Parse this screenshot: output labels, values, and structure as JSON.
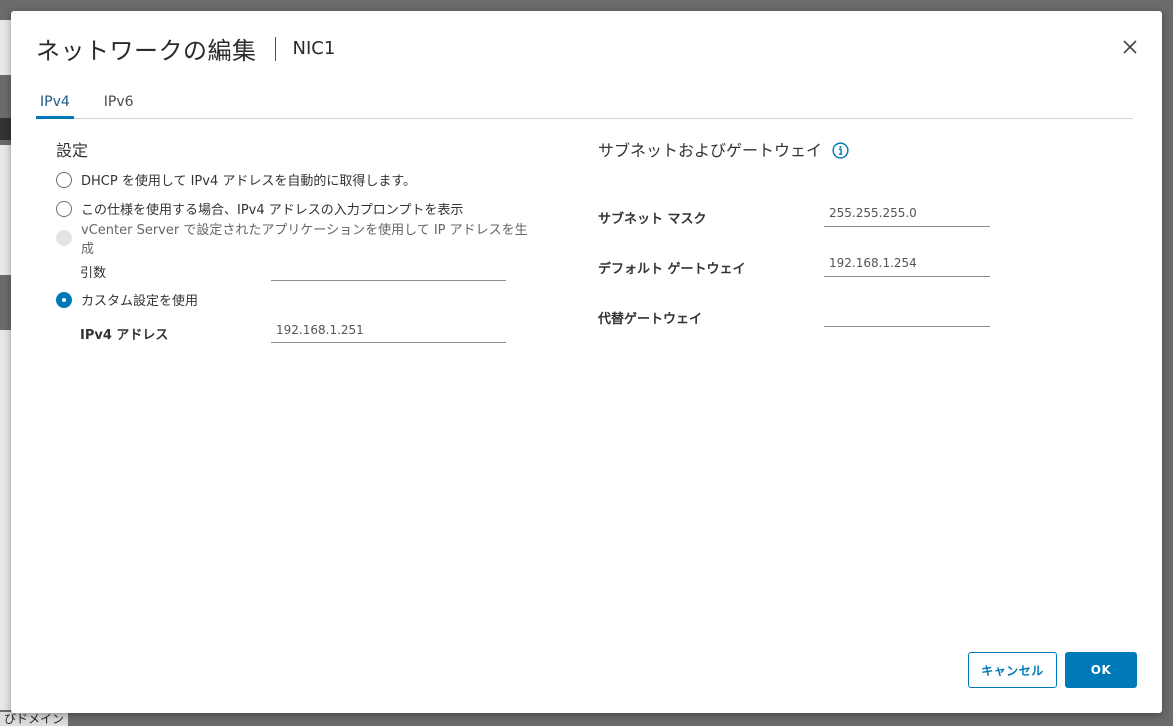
{
  "dialog": {
    "title": "ネットワークの編集",
    "subtitle": "NIC1"
  },
  "tabs": [
    {
      "label": "IPv4",
      "active": true
    },
    {
      "label": "IPv6",
      "active": false
    }
  ],
  "settings": {
    "title": "設定",
    "options": [
      {
        "label": "DHCP を使用して IPv4 アドレスを自動的に取得します。",
        "state": "unchecked"
      },
      {
        "label": "この仕様を使用する場合、IPv4 アドレスの入力プロンプトを表示",
        "state": "unchecked"
      },
      {
        "label": "vCenter Server で設定されたアプリケーションを使用して IP アドレスを生成",
        "state": "disabled"
      },
      {
        "label": "カスタム設定を使用",
        "state": "checked"
      }
    ],
    "argument_label": "引数",
    "argument_value": "",
    "ipv4_label": "IPv4 アドレス",
    "ipv4_value": "192.168.1.251"
  },
  "subnet": {
    "title": "サブネットおよびゲートウェイ",
    "info_icon": "info-icon",
    "fields": [
      {
        "label": "サブネット マスク",
        "value": "255.255.255.0"
      },
      {
        "label": "デフォルト ゲートウェイ",
        "value": "192.168.1.254"
      },
      {
        "label": "代替ゲートウェイ",
        "value": ""
      }
    ]
  },
  "buttons": {
    "cancel": "キャンセル",
    "ok": "OK"
  },
  "background": {
    "bottom_text": "びドメイン"
  },
  "colors": {
    "accent": "#0079b8",
    "overlay": "#6b6b6b"
  }
}
